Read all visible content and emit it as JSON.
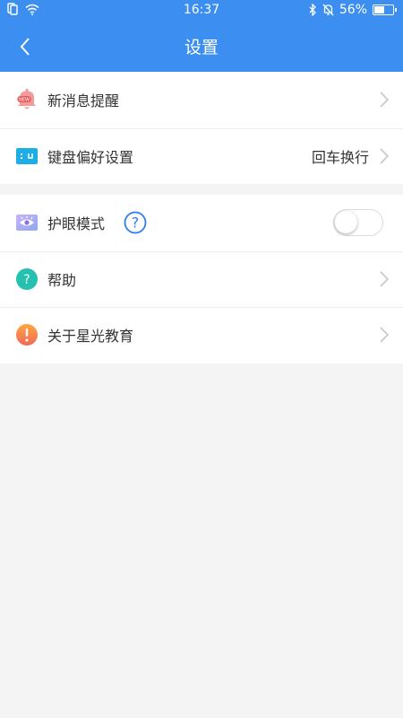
{
  "status_bar": {
    "time": "16:37",
    "battery_text": "56%",
    "battery_level": 0.56,
    "icons": [
      "sim-icon",
      "wifi-icon",
      "bluetooth-icon",
      "mute-icon",
      "battery-icon"
    ]
  },
  "header": {
    "title": "设置",
    "back_icon": "back-arrow-icon"
  },
  "settings": {
    "group1": [
      {
        "label": "新消息提醒",
        "icon": "new-message-bell-icon"
      },
      {
        "label": "键盘偏好设置",
        "value": "回车换行",
        "icon": "keyboard-icon"
      }
    ],
    "group2": [
      {
        "label": "护眼模式",
        "icon": "eye-icon",
        "toggle_on": false
      },
      {
        "label": "帮助",
        "icon": "help-icon"
      },
      {
        "label": "关于星光教育",
        "icon": "info-icon"
      }
    ]
  },
  "colors": {
    "header_bg": "#3c8ef1",
    "page_bg": "#f4f4f5",
    "link_blue": "#2f7de6"
  }
}
